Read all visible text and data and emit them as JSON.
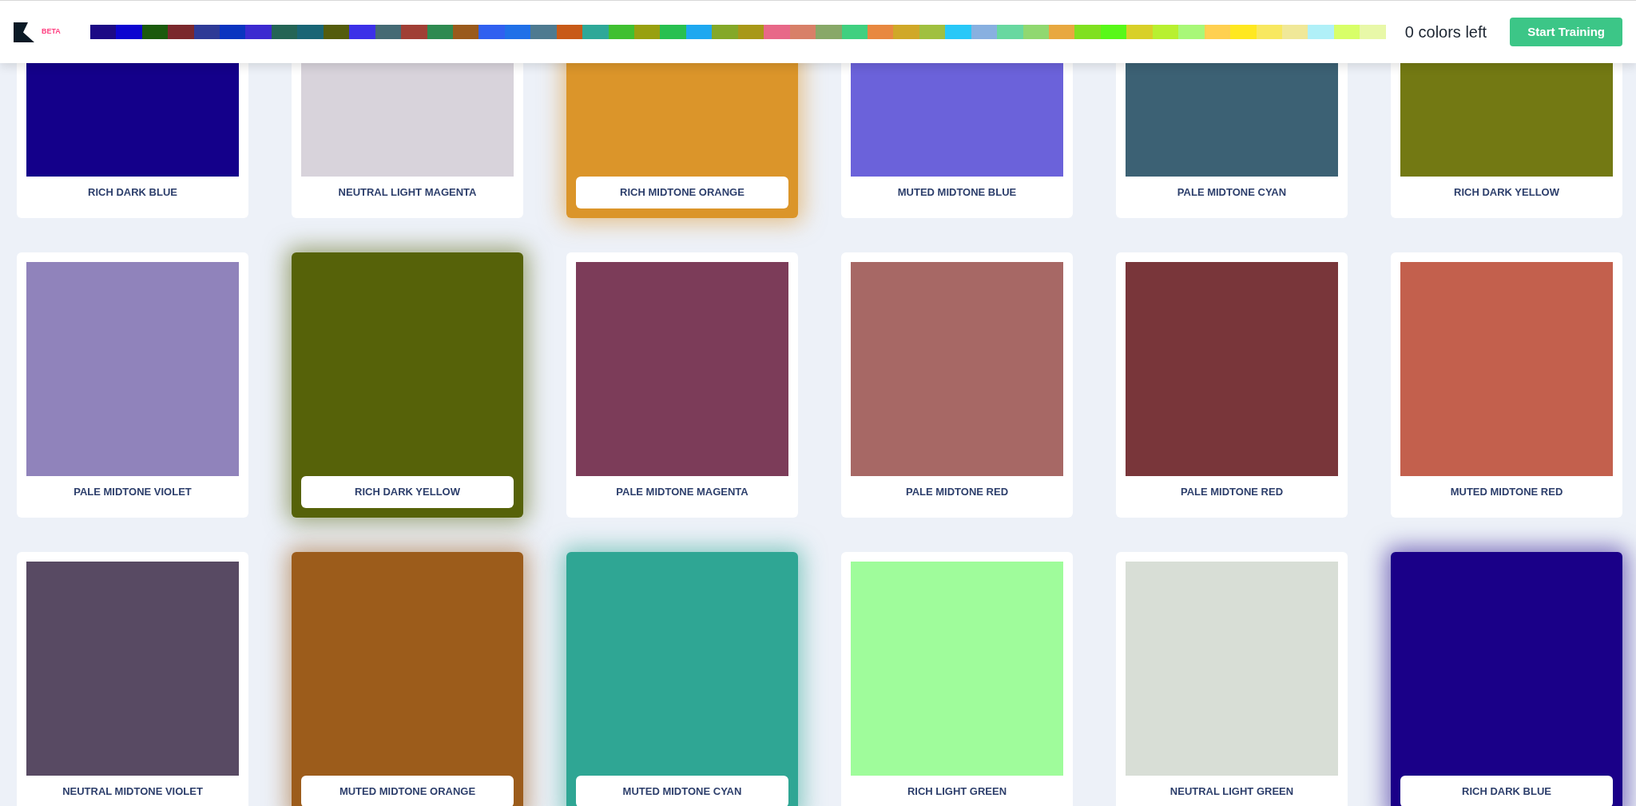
{
  "header": {
    "badge": "BETA",
    "swatches": [
      {
        "color": "#1c0a85"
      },
      {
        "color": "#0c05d0"
      },
      {
        "color": "#1b5a0c"
      },
      {
        "color": "#7a282c"
      },
      {
        "color": "#2e3a96"
      },
      {
        "color": "#0a34c0"
      },
      {
        "color": "#3c2ad0"
      },
      {
        "color": "#246455"
      },
      {
        "color": "#196575"
      },
      {
        "color": "#545c0d"
      },
      {
        "color": "#3c30e8"
      },
      {
        "color": "#456a74"
      },
      {
        "color": "#a03f35"
      },
      {
        "color": "#2e8a50"
      },
      {
        "color": "#9a5a1c"
      },
      {
        "color": "#3060f0"
      },
      {
        "color": "#2070e8"
      },
      {
        "color": "#4e7a90"
      },
      {
        "color": "#c85a18"
      },
      {
        "color": "#2ea898"
      },
      {
        "color": "#40c030"
      },
      {
        "color": "#98a010"
      },
      {
        "color": "#28c050"
      },
      {
        "color": "#1ea8f0"
      },
      {
        "color": "#84a828"
      },
      {
        "color": "#a89818"
      },
      {
        "color": "#e86888"
      },
      {
        "color": "#d88068"
      },
      {
        "color": "#88a868"
      },
      {
        "color": "#40d080"
      },
      {
        "color": "#e88840"
      },
      {
        "color": "#d0a828"
      },
      {
        "color": "#a0c040"
      },
      {
        "color": "#28c8f8"
      },
      {
        "color": "#88b0e0"
      },
      {
        "color": "#68d8a0"
      },
      {
        "color": "#90d870"
      },
      {
        "color": "#e8a840"
      },
      {
        "color": "#80e020"
      },
      {
        "color": "#58f818"
      },
      {
        "color": "#d8d028"
      },
      {
        "color": "#b8f030"
      },
      {
        "color": "#a8f878"
      },
      {
        "color": "#ffd050"
      },
      {
        "color": "#ffe820"
      },
      {
        "color": "#f8e860"
      },
      {
        "color": "#f0e898"
      },
      {
        "color": "#b0f0f8"
      },
      {
        "color": "#d8ff68"
      },
      {
        "color": "#e8f8a8"
      }
    ],
    "colors_left": "0 colors left",
    "button": "Start Training"
  },
  "cards": [
    {
      "label": "RICH DARK BLUE",
      "color": "#14008a",
      "selected": false
    },
    {
      "label": "NEUTRAL LIGHT MAGENTA",
      "color": "#d8d3db",
      "selected": false
    },
    {
      "label": "RICH MIDTONE ORANGE",
      "color": "#db952a",
      "selected": true
    },
    {
      "label": "MUTED MIDTONE BLUE",
      "color": "#6b62da",
      "selected": false
    },
    {
      "label": "PALE MIDTONE CYAN",
      "color": "#3c6174",
      "selected": false
    },
    {
      "label": "RICH DARK YELLOW",
      "color": "#737913",
      "selected": false
    },
    {
      "label": "PALE MIDTONE VIOLET",
      "color": "#9083bb",
      "selected": false
    },
    {
      "label": "RICH DARK YELLOW",
      "color": "#566209",
      "selected": true
    },
    {
      "label": "PALE MIDTONE MAGENTA",
      "color": "#7c3c59",
      "selected": false
    },
    {
      "label": "PALE MIDTONE RED",
      "color": "#a76865",
      "selected": false
    },
    {
      "label": "PALE MIDTONE RED",
      "color": "#79363a",
      "selected": false
    },
    {
      "label": "MUTED MIDTONE RED",
      "color": "#c3604d",
      "selected": false
    },
    {
      "label": "NEUTRAL MIDTONE VIOLET",
      "color": "#584a63",
      "selected": false
    },
    {
      "label": "MUTED MIDTONE ORANGE",
      "color": "#9c5c1b",
      "selected": true
    },
    {
      "label": "MUTED MIDTONE CYAN",
      "color": "#2fa694",
      "selected": true
    },
    {
      "label": "RICH LIGHT GREEN",
      "color": "#9ffc9b",
      "selected": false
    },
    {
      "label": "NEUTRAL LIGHT GREEN",
      "color": "#d8ded6",
      "selected": false
    },
    {
      "label": "RICH DARK BLUE",
      "color": "#1a0088",
      "selected": true
    }
  ]
}
